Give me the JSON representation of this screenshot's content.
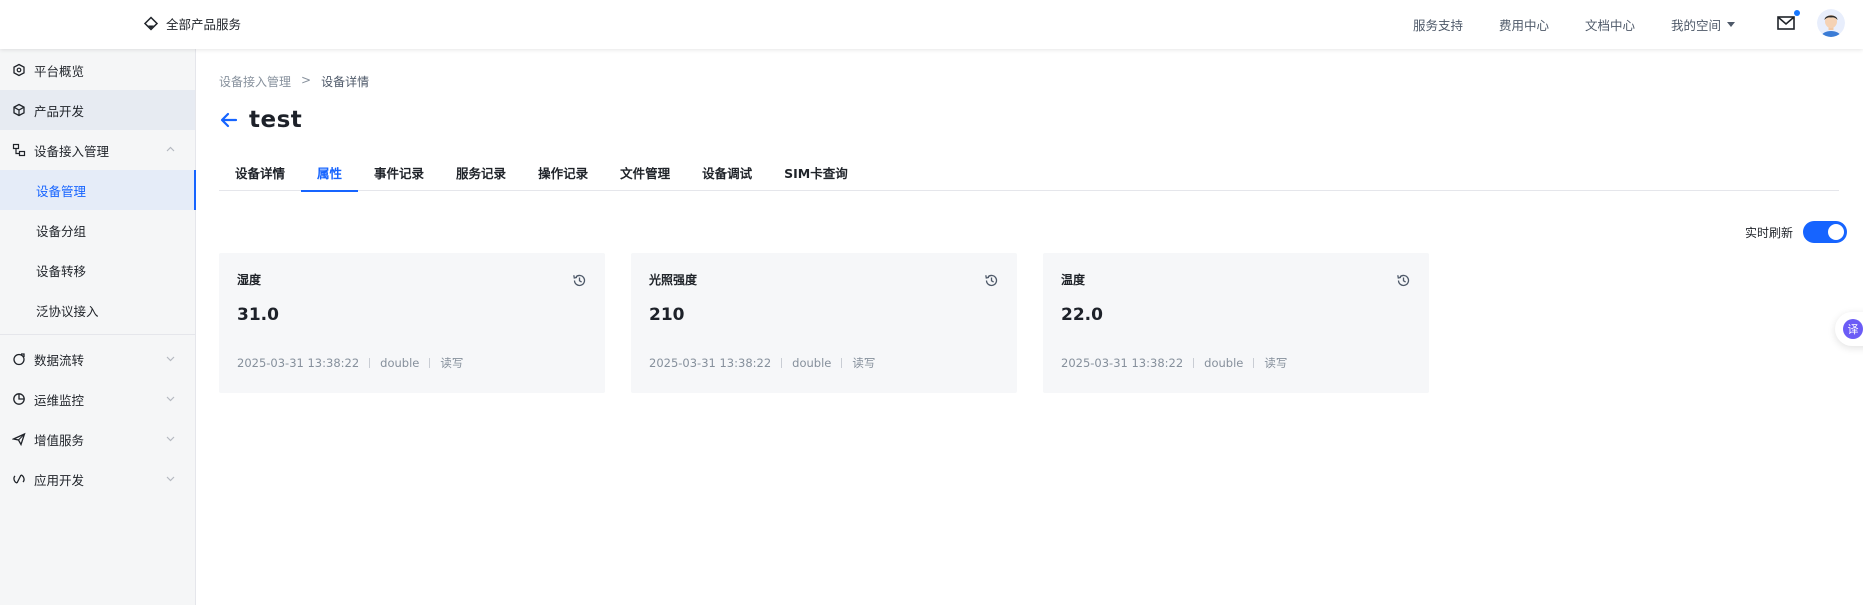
{
  "topbar": {
    "all_products": "全部产品服务",
    "nav": [
      {
        "label": "服务支持"
      },
      {
        "label": "费用中心"
      },
      {
        "label": "文档中心"
      },
      {
        "label": "我的空间"
      }
    ],
    "mail_icon": "mail-icon",
    "notification_color": "#1677ff"
  },
  "sidebar": {
    "items": [
      {
        "label": "平台概览",
        "icon": "cube-outline-icon"
      },
      {
        "label": "产品开发",
        "icon": "box-icon"
      },
      {
        "label": "设备接入管理",
        "icon": "device-tree-icon",
        "expanded": true
      },
      {
        "label": "设备管理",
        "sub": true,
        "selected": true
      },
      {
        "label": "设备分组",
        "sub": true
      },
      {
        "label": "设备转移",
        "sub": true
      },
      {
        "label": "泛协议接入",
        "sub": true
      },
      {
        "label": "数据流转",
        "icon": "data-flow-icon"
      },
      {
        "label": "运维监控",
        "icon": "pie-chart-icon"
      },
      {
        "label": "增值服务",
        "icon": "send-icon"
      },
      {
        "label": "应用开发",
        "icon": "app-dev-icon"
      }
    ]
  },
  "breadcrumb": {
    "parent": "设备接入管理",
    "separator": ">",
    "current": "设备详情"
  },
  "page": {
    "title": "test"
  },
  "tabs": [
    {
      "label": "设备详情"
    },
    {
      "label": "属性",
      "active": true
    },
    {
      "label": "事件记录"
    },
    {
      "label": "服务记录"
    },
    {
      "label": "操作记录"
    },
    {
      "label": "文件管理"
    },
    {
      "label": "设备调试"
    },
    {
      "label": "SIM卡查询"
    }
  ],
  "realtime": {
    "label": "实时刷新",
    "enabled": true
  },
  "cards": [
    {
      "name": "湿度",
      "value": "31.0",
      "time": "2025-03-31 13:38:22",
      "type": "double",
      "access": "读写"
    },
    {
      "name": "光照强度",
      "value": "210",
      "time": "2025-03-31 13:38:22",
      "type": "double",
      "access": "读写"
    },
    {
      "name": "温度",
      "value": "22.0",
      "time": "2025-03-31 13:38:22",
      "type": "double",
      "access": "读写"
    }
  ],
  "translate": {
    "glyph": "译"
  },
  "colors": {
    "accent": "#1664ff",
    "sidebar_bg": "#f5f6f7",
    "card_bg": "#f6f7f9"
  }
}
